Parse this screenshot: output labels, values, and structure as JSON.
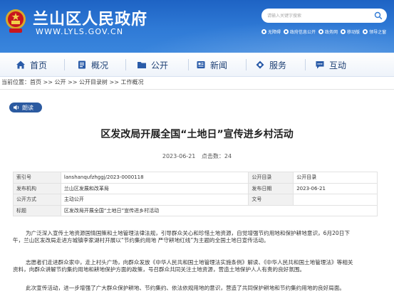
{
  "header": {
    "title": "兰山区人民政府",
    "url": "WWW.LYLS.GOV.CN",
    "search_placeholder": "请输入关键字搜索",
    "links": [
      "无障碍",
      "政府信息公开",
      "政务网",
      "移动版",
      "领导之窗"
    ]
  },
  "nav": {
    "items": [
      {
        "label": "首页",
        "icon": "home-icon"
      },
      {
        "label": "概况",
        "icon": "overview-icon"
      },
      {
        "label": "公开",
        "icon": "folder-icon"
      },
      {
        "label": "新闻",
        "icon": "newspaper-icon"
      },
      {
        "label": "服务",
        "icon": "service-icon"
      },
      {
        "label": "互动",
        "icon": "chat-icon"
      }
    ]
  },
  "breadcrumb": "当前位置：首页 >> 公开 >> 公开目录树 >> 工作概况",
  "read_button": "朗读",
  "article": {
    "title": "区发改局开展全国“土地日”宣传进乡村活动",
    "date": "2023-06-21",
    "views": "点击数：24"
  },
  "info_table": {
    "rows": [
      [
        "索引号",
        "lanshanqufzhggj/2023-0000118",
        "公开目录",
        "公开目录"
      ],
      [
        "发布机构",
        "兰山区发展和改革局",
        "发布日期",
        "2023-06-21"
      ],
      [
        "公开方式",
        "主动公开",
        "文号",
        ""
      ],
      [
        "标题",
        "区发改局开展全国“土地日”宣传进乡村活动"
      ]
    ]
  },
  "paragraphs": {
    "p1": [
      "为广泛深入宣传土地资源国情国策和土地管理法律法规，引导群众关心和珍惜土地资源，自觉增强节约用地和保护耕地意识，6月20日下",
      "午，兰山区发改局走进方城镇李家湖村开展以“节约集约用地 严守耕地红线”为主题的全国土地日宣传活动。"
    ],
    "p2": [
      "志愿者们走进群众家中，走上村头广场，向群众发放《中华人民共和国土地管理法实施条例》解读、《中华人民共和国土地管理法》等相关",
      "资料，向群众讲解节约集约用地和耕地保护方面的政策，号召群众共同关注土地资源，营造土地保护人人有责的良好氛围。"
    ],
    "p3": [
      "此次宣传活动，进一步增强了广大群众保护耕地、节约集约、依法依规用地的意识，营造了共同保护耕地和节约集约用地的良好局面。"
    ]
  },
  "colors": {
    "header_blue": "#2f7ad6",
    "nav_text": "#1d3f73",
    "read_button": "#2b5aa0"
  }
}
